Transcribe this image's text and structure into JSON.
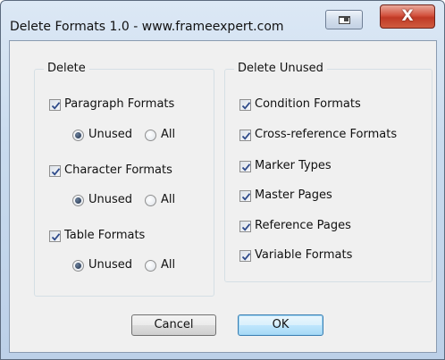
{
  "window": {
    "title": "Delete Formats 1.0 - www.frameexpert.com"
  },
  "titlebar_buttons": {
    "restore_icon": "restore-window-icon",
    "close_icon": "close-x-icon",
    "close_glyph": "X"
  },
  "delete_group": {
    "legend": "Delete",
    "sections": [
      {
        "label": "Paragraph Formats",
        "checked": true,
        "radio_unused": "Unused",
        "radio_all": "All",
        "selected": "Unused"
      },
      {
        "label": "Character Formats",
        "checked": true,
        "radio_unused": "Unused",
        "radio_all": "All",
        "selected": "Unused"
      },
      {
        "label": "Table Formats",
        "checked": true,
        "radio_unused": "Unused",
        "radio_all": "All",
        "selected": "Unused"
      }
    ]
  },
  "delete_unused_group": {
    "legend": "Delete Unused",
    "items": [
      {
        "label": "Condition Formats",
        "checked": true
      },
      {
        "label": "Cross-reference Formats",
        "checked": true
      },
      {
        "label": "Marker Types",
        "checked": true
      },
      {
        "label": "Master Pages",
        "checked": true
      },
      {
        "label": "Reference Pages",
        "checked": true
      },
      {
        "label": "Variable Formats",
        "checked": true
      }
    ]
  },
  "buttons": {
    "cancel": "Cancel",
    "ok": "OK"
  },
  "colors": {
    "check": "#2d4a8a",
    "radio_dot": "#1f2f4a",
    "close_red": "#c9472f"
  }
}
